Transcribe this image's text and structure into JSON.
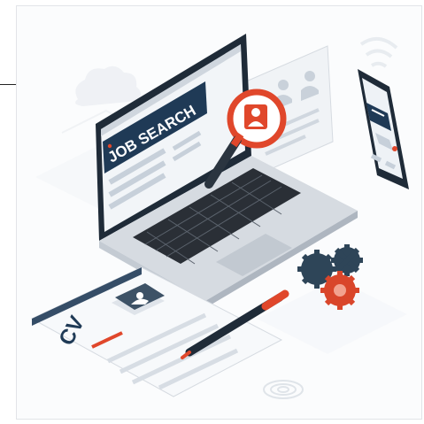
{
  "illustration": {
    "screen_title": "JOB SEARCH",
    "document_label": "CV",
    "colors": {
      "navy": "#1f3a56",
      "accent_red": "#e0472b",
      "light_gray": "#e7ebf0",
      "mid_gray": "#b9c1cb",
      "silver": "#cfd4da",
      "keyboard": "#2a2f36",
      "gear_dark": "#2e4558",
      "gear_red": "#d9462b"
    },
    "icons": [
      "laptop-icon",
      "magnifier-icon",
      "user-profile-icon",
      "smartphone-icon",
      "cv-document-icon",
      "pen-icon",
      "gears-icon",
      "cloud-icon",
      "wifi-icon"
    ]
  }
}
